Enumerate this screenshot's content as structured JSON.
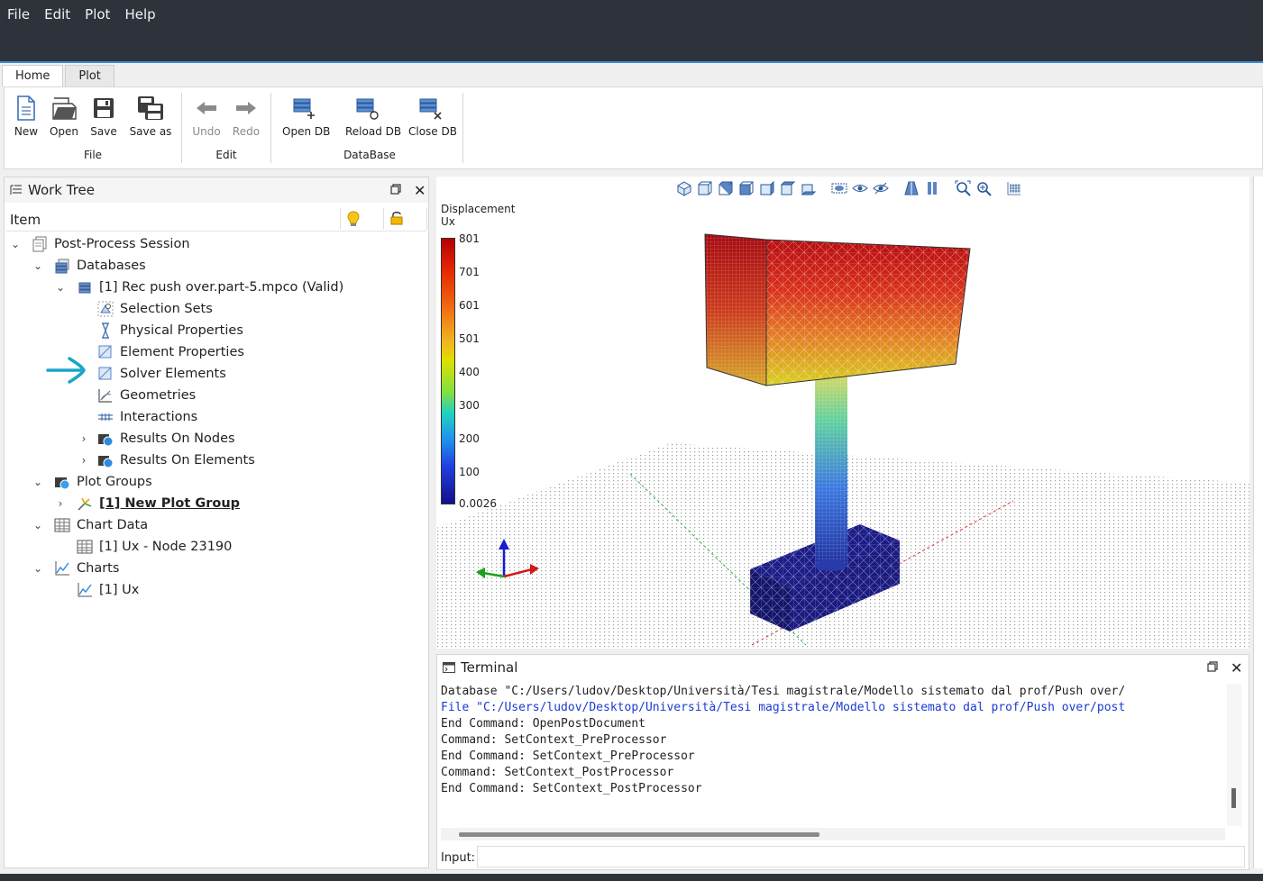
{
  "menu": [
    "File",
    "Edit",
    "Plot",
    "Help"
  ],
  "ribbon": {
    "tabs": [
      "Home",
      "Plot"
    ],
    "groups": {
      "file": {
        "label": "File",
        "buttons": [
          "New",
          "Open",
          "Save",
          "Save as"
        ]
      },
      "edit": {
        "label": "Edit",
        "buttons": [
          "Undo",
          "Redo"
        ]
      },
      "database": {
        "label": "DataBase",
        "buttons": [
          "Open DB",
          "Reload DB",
          "Close DB"
        ]
      }
    }
  },
  "worktree": {
    "title": "Work Tree",
    "column_item": "Item",
    "items": [
      "Post-Process Session",
      "Databases",
      "[1] Rec push over.part-5.mpco (Valid)",
      "Selection Sets",
      "Physical Properties",
      "Element Properties",
      "Solver Elements",
      "Geometries",
      "Interactions",
      "Results On Nodes",
      "Results On Elements",
      "Plot Groups",
      "[1] New Plot Group",
      "Chart Data",
      "[1] Ux - Node 23190",
      "Charts",
      "[1] Ux"
    ]
  },
  "viewport": {
    "legend_title": "Displacement",
    "legend_subtitle": "Ux",
    "legend_ticks": [
      "801",
      "701",
      "601",
      "501",
      "400",
      "300",
      "200",
      "100",
      "0.0026"
    ]
  },
  "terminal": {
    "title": "Terminal",
    "lines": [
      "Database \"C:/Users/ludov/Desktop/Università/Tesi magistrale/Modello sistemato dal prof/Push over/",
      "File \"C:/Users/ludov/Desktop/Università/Tesi magistrale/Modello sistemato dal prof/Push over/post",
      "End Command: OpenPostDocument",
      "Command: SetContext_PreProcessor",
      "End Command: SetContext_PreProcessor",
      "Command: SetContext_PostProcessor",
      "End Command: SetContext_PostProcessor"
    ],
    "input_label": "Input:",
    "input_value": ""
  },
  "colors": {
    "titlebar": "#2d323b",
    "accent": "#3a8ad6",
    "annotation_arrow": "#1aa6c8",
    "terminal_blue": "#1a3cd0"
  }
}
